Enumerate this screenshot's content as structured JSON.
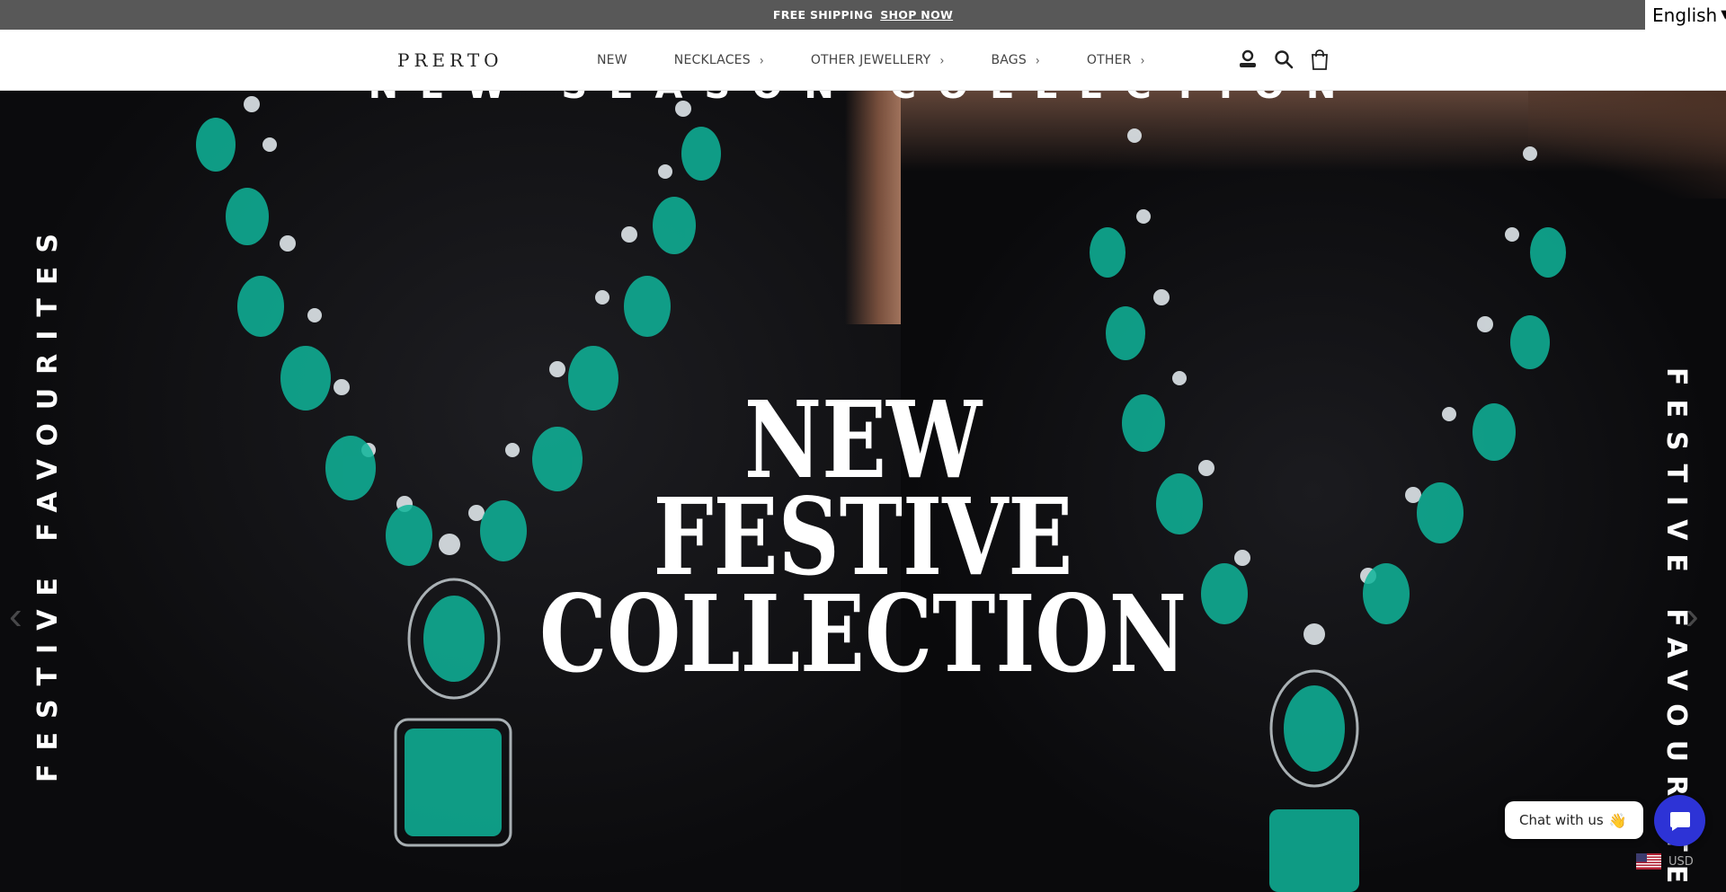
{
  "announcement": {
    "text": "FREE SHIPPING",
    "link": "SHOP NOW"
  },
  "language": {
    "selected": "English"
  },
  "header": {
    "logo": "PRERTO",
    "nav": [
      {
        "label": "NEW",
        "has_submenu": false
      },
      {
        "label": "NECKLACES",
        "has_submenu": true
      },
      {
        "label": "OTHER JEWELLERY",
        "has_submenu": true
      },
      {
        "label": "BAGS",
        "has_submenu": true
      },
      {
        "label": "OTHER",
        "has_submenu": true
      }
    ],
    "icons": [
      "account-icon",
      "search-icon",
      "cart-icon"
    ]
  },
  "hero": {
    "subtitle": "NEW SEASON COLLECTION",
    "headline": [
      "NEW",
      "FESTIVE",
      "COLLECTION"
    ],
    "side_left": "FESTIVE FAVOURITES",
    "side_right": "FESTIVE FAVOURITES",
    "accent": "#0fb59a"
  },
  "chat": {
    "label": "Chat with us",
    "emoji": "👋",
    "button_color": "#2d33d6"
  },
  "currency": {
    "code": "USD"
  }
}
